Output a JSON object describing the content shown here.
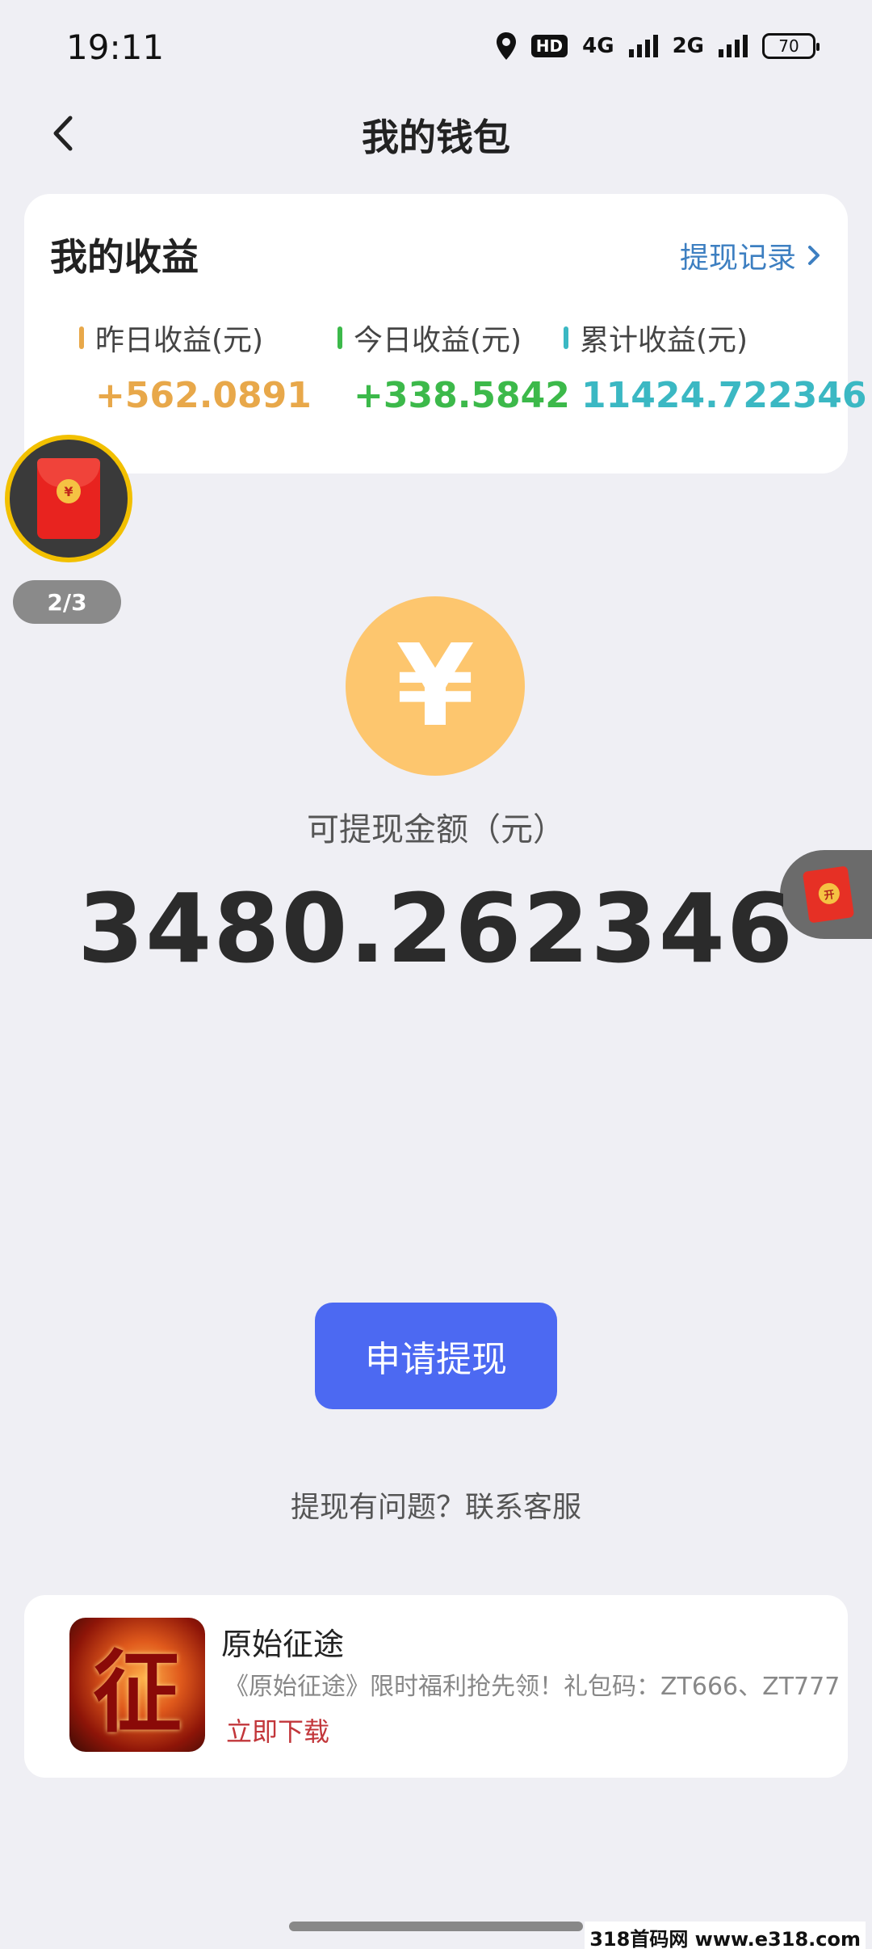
{
  "status_bar": {
    "time": "19:11",
    "hd_label": "HD",
    "net_4g": "4G",
    "net_2g": "2G",
    "battery": "70"
  },
  "nav": {
    "back_icon": "chevron-left-icon",
    "title": "我的钱包"
  },
  "earnings": {
    "title": "我的收益",
    "record_link": "提现记录",
    "stats": [
      {
        "label": "昨日收益(元)",
        "value": "+562.0891",
        "color": "#e8a84a"
      },
      {
        "label": "今日收益(元)",
        "value": "+338.5842",
        "color": "#3cb94a"
      },
      {
        "label": "累计收益(元)",
        "value": "11424.722346",
        "color": "#3bb8c3"
      }
    ]
  },
  "float_left": {
    "icon": "red-envelope-icon",
    "coin_symbol": "¥",
    "count": "2/3"
  },
  "float_right": {
    "icon": "red-envelope-icon",
    "badge": "开"
  },
  "balance": {
    "coin_symbol": "¥",
    "label": "可提现金额（元）",
    "amount": "3480.262346"
  },
  "withdraw_button": "申请提现",
  "help_link": "提现有问题？联系客服",
  "ad": {
    "image_char": "征",
    "title": "原始征途",
    "description": "《原始征途》限时福利抢先领！礼包码：ZT666、ZT777",
    "cta": "立即下载"
  },
  "watermark": "318首码网 www.e318.com",
  "colors": {
    "accent_blue": "#4c69f2",
    "link_blue": "#3d7fc1",
    "coin_yellow": "#fdc66e"
  }
}
